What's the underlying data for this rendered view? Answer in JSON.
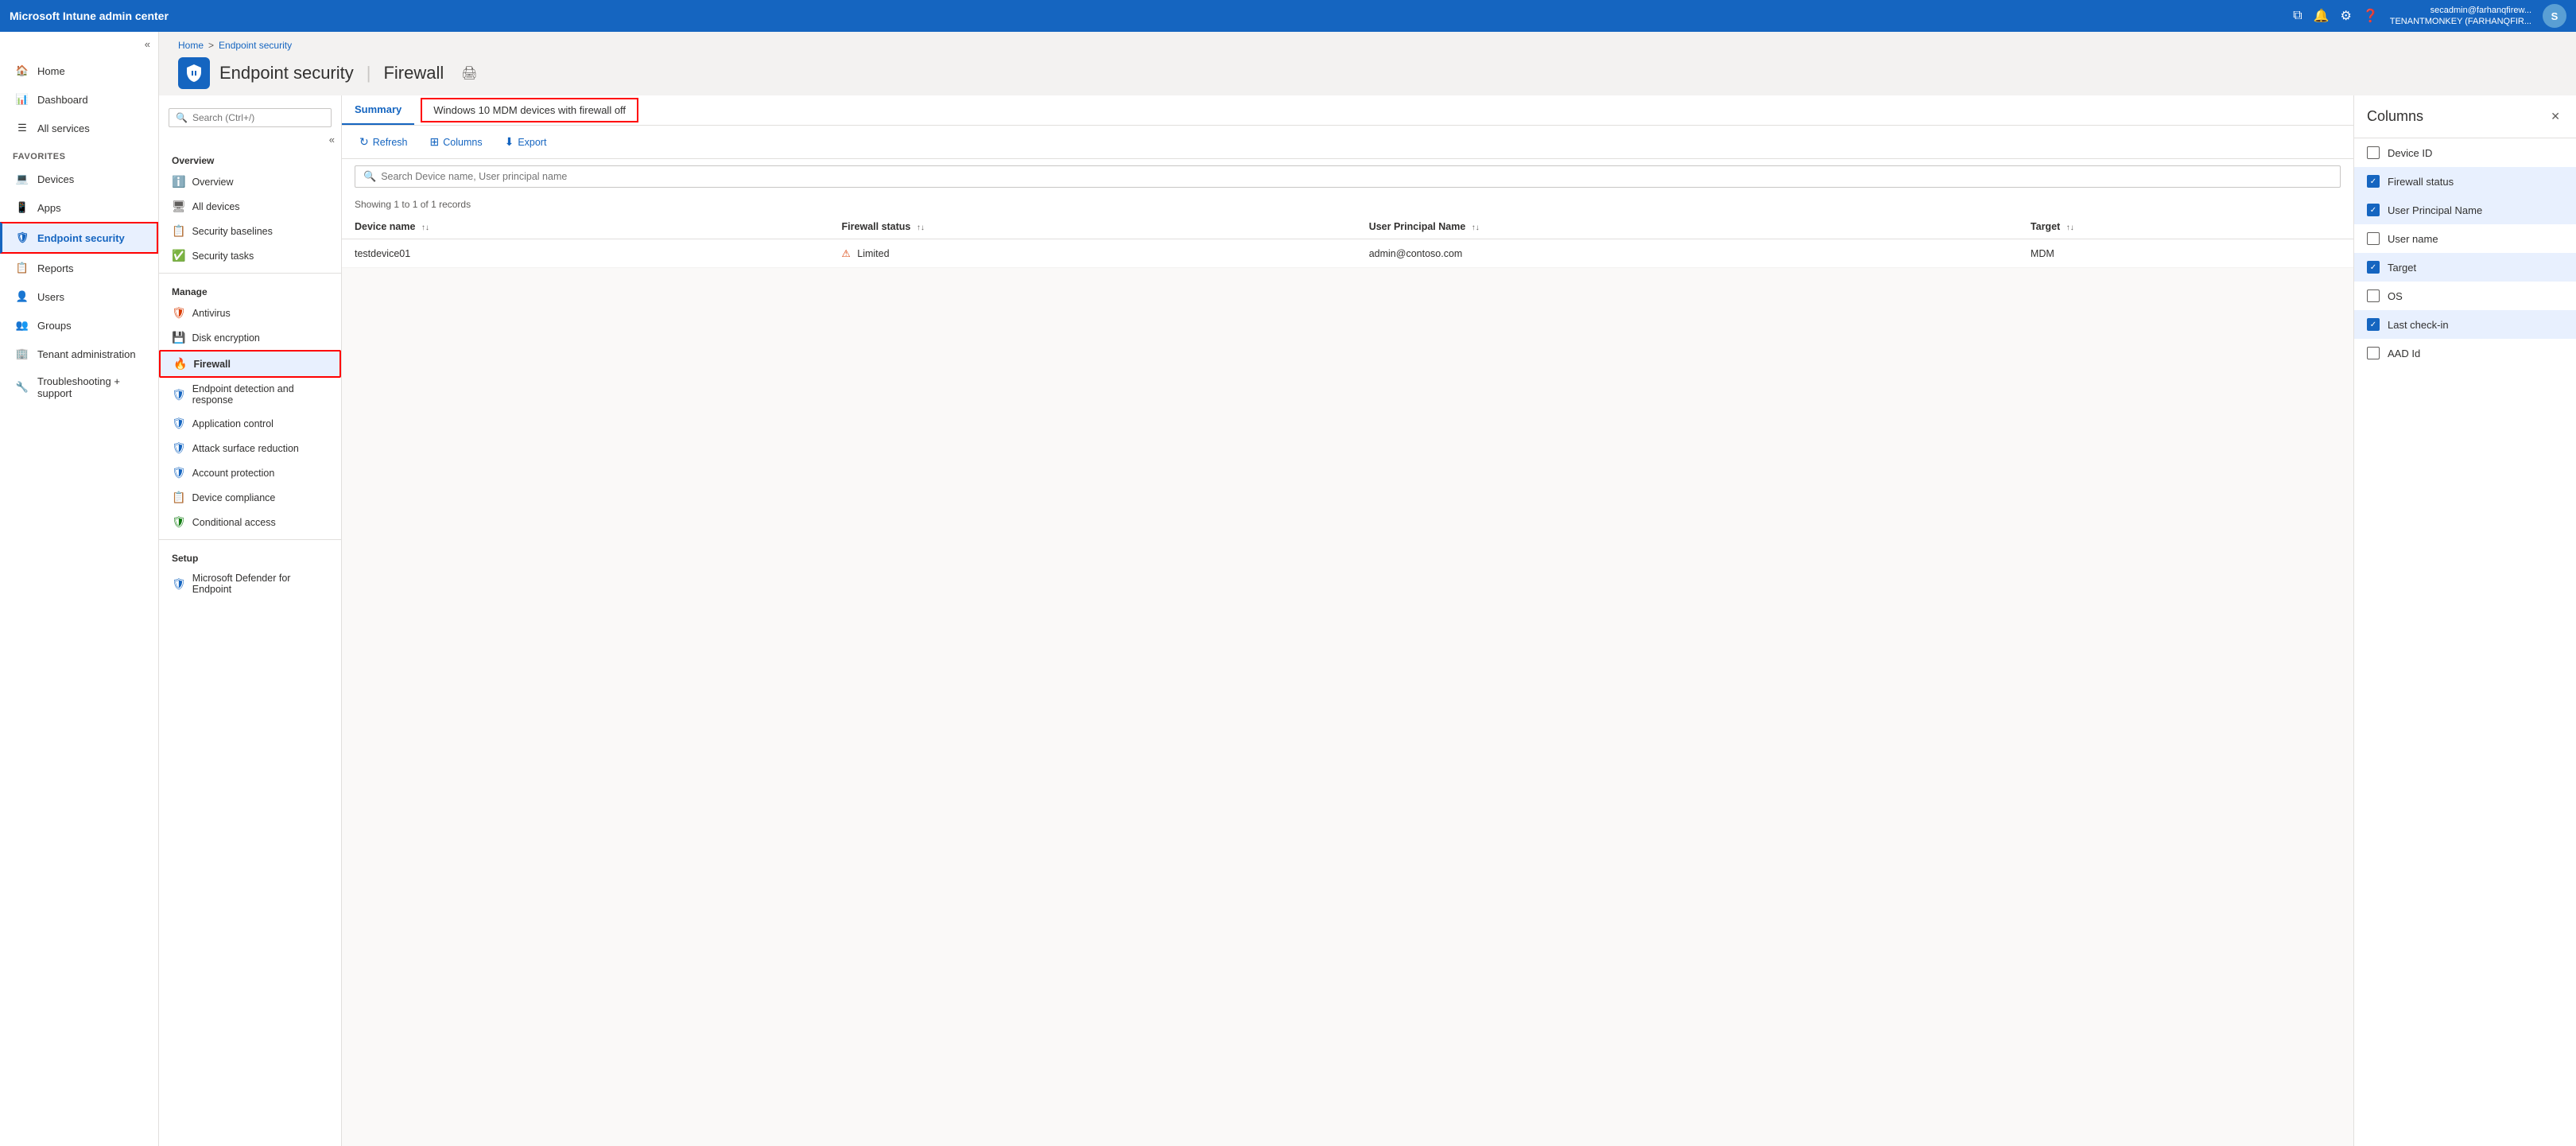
{
  "topbar": {
    "title": "Microsoft Intune admin center",
    "user_line1": "secadmin@farhanqfirew...",
    "user_line2": "TENANTMONKEY (FARHANQFIR...",
    "avatar_initials": "S"
  },
  "breadcrumb": {
    "home": "Home",
    "separator": ">",
    "current": "Endpoint security"
  },
  "page_header": {
    "title": "Endpoint security",
    "separator": "|",
    "subtitle": "Firewall",
    "icon": "🔒"
  },
  "sidebar": {
    "collapse_icon": "«",
    "items": [
      {
        "id": "home",
        "label": "Home",
        "icon": "🏠"
      },
      {
        "id": "dashboard",
        "label": "Dashboard",
        "icon": "📊"
      },
      {
        "id": "all-services",
        "label": "All services",
        "icon": "⚙"
      }
    ],
    "favorites_label": "FAVORITES",
    "favorites": [
      {
        "id": "devices",
        "label": "Devices",
        "icon": "💻"
      },
      {
        "id": "apps",
        "label": "Apps",
        "icon": "📱"
      },
      {
        "id": "endpoint-security",
        "label": "Endpoint security",
        "icon": "🛡",
        "active": true
      },
      {
        "id": "reports",
        "label": "Reports",
        "icon": "📋"
      },
      {
        "id": "users",
        "label": "Users",
        "icon": "👤"
      },
      {
        "id": "groups",
        "label": "Groups",
        "icon": "👥"
      },
      {
        "id": "tenant-admin",
        "label": "Tenant administration",
        "icon": "🏢"
      },
      {
        "id": "troubleshooting",
        "label": "Troubleshooting + support",
        "icon": "🔧"
      }
    ]
  },
  "left_panel": {
    "search_placeholder": "Search (Ctrl+/)",
    "overview_section": "Overview",
    "overview_items": [
      {
        "id": "overview",
        "label": "Overview",
        "icon": "ℹ"
      },
      {
        "id": "all-devices",
        "label": "All devices",
        "icon": "🖥"
      },
      {
        "id": "security-baselines",
        "label": "Security baselines",
        "icon": "📋"
      },
      {
        "id": "security-tasks",
        "label": "Security tasks",
        "icon": "✅"
      }
    ],
    "manage_section": "Manage",
    "manage_items": [
      {
        "id": "antivirus",
        "label": "Antivirus",
        "icon": "🛡",
        "color": "red"
      },
      {
        "id": "disk-encryption",
        "label": "Disk encryption",
        "icon": "💾",
        "color": "blue"
      },
      {
        "id": "firewall",
        "label": "Firewall",
        "icon": "🔥",
        "color": "blue",
        "selected": true,
        "highlighted": true
      },
      {
        "id": "edr",
        "label": "Endpoint detection and response",
        "icon": "🛡",
        "color": "blue"
      },
      {
        "id": "app-control",
        "label": "Application control",
        "icon": "🛡",
        "color": "blue"
      },
      {
        "id": "attack-surface",
        "label": "Attack surface reduction",
        "icon": "🛡",
        "color": "blue"
      },
      {
        "id": "account-protection",
        "label": "Account protection",
        "icon": "🛡",
        "color": "blue"
      },
      {
        "id": "device-compliance",
        "label": "Device compliance",
        "icon": "📋",
        "color": "blue"
      },
      {
        "id": "conditional-access",
        "label": "Conditional access",
        "icon": "🛡",
        "color": "green"
      }
    ],
    "setup_section": "Setup",
    "setup_items": [
      {
        "id": "ms-defender-endpoint",
        "label": "Microsoft Defender for Endpoint",
        "icon": "🛡",
        "color": "blue"
      }
    ]
  },
  "summary": {
    "tab_label": "Summary",
    "highlighted_tab_label": "Windows 10 MDM devices with firewall off"
  },
  "toolbar": {
    "refresh_label": "Refresh",
    "columns_label": "Columns",
    "export_label": "Export"
  },
  "search_bar": {
    "placeholder": "Search Device name, User principal name"
  },
  "record_info": {
    "showing": "Showing 1 to 1 of 1 records"
  },
  "table": {
    "columns": [
      {
        "id": "device-name",
        "label": "Device name",
        "sortable": true
      },
      {
        "id": "firewall-status",
        "label": "Firewall status",
        "sortable": true
      },
      {
        "id": "user-principal-name",
        "label": "User Principal Name",
        "sortable": true
      },
      {
        "id": "target",
        "label": "Target",
        "sortable": true
      }
    ],
    "rows": [
      {
        "device_name": "testdevice01",
        "firewall_status": "Limited",
        "firewall_warning": true,
        "user_principal_name": "admin@contoso.com",
        "target": "MDM"
      }
    ]
  },
  "columns_panel": {
    "title": "Columns",
    "close_icon": "✕",
    "items": [
      {
        "id": "device-id",
        "label": "Device ID",
        "checked": false
      },
      {
        "id": "firewall-status",
        "label": "Firewall status",
        "checked": true
      },
      {
        "id": "user-principal-name",
        "label": "User Principal Name",
        "checked": true
      },
      {
        "id": "user-name",
        "label": "User name",
        "checked": false
      },
      {
        "id": "target",
        "label": "Target",
        "checked": true
      },
      {
        "id": "os",
        "label": "OS",
        "checked": false
      },
      {
        "id": "last-check-in",
        "label": "Last check-in",
        "checked": true
      },
      {
        "id": "aad-id",
        "label": "AAD Id",
        "checked": false
      }
    ]
  }
}
